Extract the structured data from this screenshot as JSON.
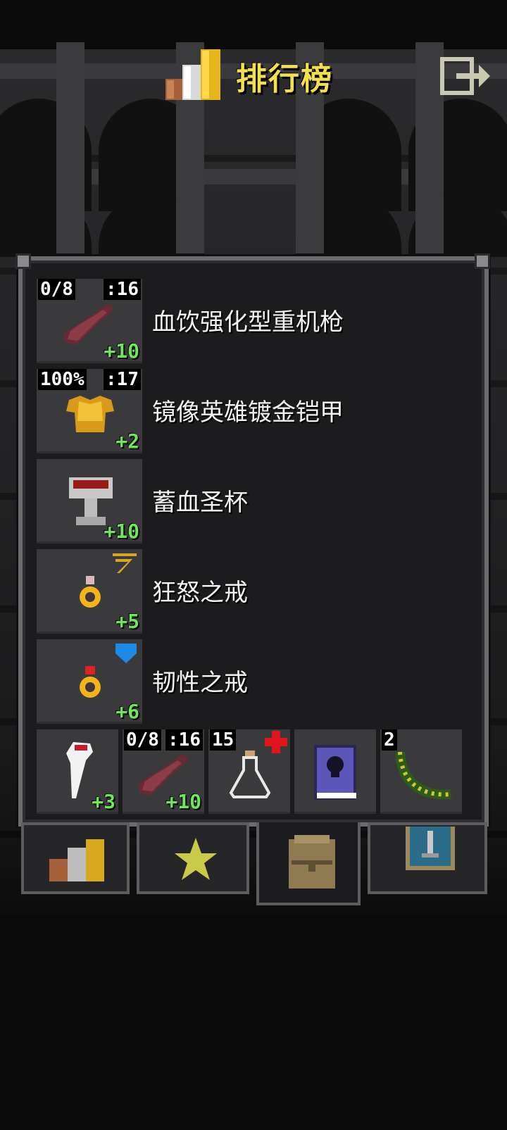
{
  "header": {
    "title": "排行榜",
    "title_color": "#f4e04a",
    "icon": "leaderboard-bars-icon",
    "exit_icon": "exit-icon"
  },
  "equipment": [
    {
      "name": "血饮强化型重机枪",
      "icon": "heavy-machine-gun-icon",
      "top_left": "0/8",
      "top_right": ":16",
      "upgrade": "+10"
    },
    {
      "name": "镜像英雄镀金铠甲",
      "icon": "gold-armor-icon",
      "top_left": "100%",
      "top_right": ":17",
      "upgrade": "+2"
    },
    {
      "name": "蓄血圣杯",
      "icon": "chalice-icon",
      "top_left": "",
      "top_right": "",
      "upgrade": "+10"
    },
    {
      "name": "狂怒之戒",
      "icon": "ring-of-fury-icon",
      "top_left": "",
      "top_right": "",
      "upgrade": "+5",
      "badge_icon": "gold-runes-icon"
    },
    {
      "name": "韧性之戒",
      "icon": "ring-of-tenacity-icon",
      "top_left": "",
      "top_right": "",
      "upgrade": "+6",
      "badge_icon": "blue-shield-icon"
    }
  ],
  "quickslots": [
    {
      "icon": "white-feather-wand-icon",
      "top_left": "",
      "top_right": "",
      "upgrade": "+3"
    },
    {
      "icon": "heavy-machine-gun-icon",
      "top_left": "0/8",
      "top_right": ":16",
      "upgrade": "+10"
    },
    {
      "icon": "empty-flask-icon",
      "top_left": "15",
      "top_right": "",
      "upgrade": "",
      "badge_icon": "red-cross-icon"
    },
    {
      "icon": "skull-spellbook-icon",
      "top_left": "",
      "top_right": "",
      "upgrade": ""
    },
    {
      "icon": "seed-pod-icon",
      "top_left": "2",
      "top_right": "",
      "upgrade": ""
    }
  ],
  "tabs": [
    {
      "icon": "leaderboard-bars-icon",
      "active": false
    },
    {
      "icon": "star-icon",
      "active": false
    },
    {
      "icon": "backpack-icon",
      "active": true
    },
    {
      "icon": "sword-card-icon",
      "active": false
    }
  ],
  "colors": {
    "upgrade_green": "#6ee85a",
    "panel_border": "#6c6c70",
    "slot_bg": "#3a3a3c"
  }
}
